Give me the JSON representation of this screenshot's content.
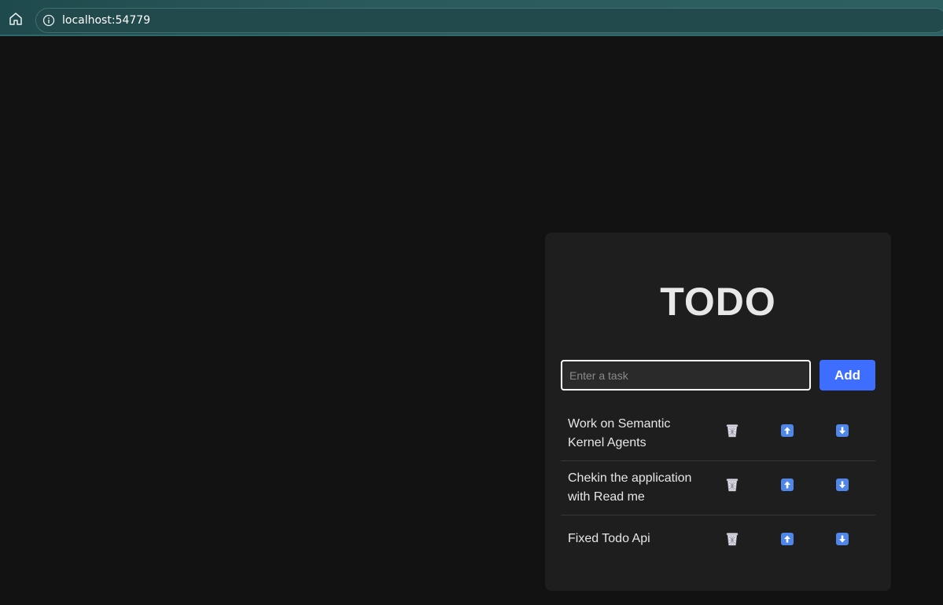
{
  "browser": {
    "url": "localhost:54779"
  },
  "app": {
    "title": "TODO",
    "input_placeholder": "Enter a task",
    "input_value": "",
    "add_label": "Add"
  },
  "tasks": [
    {
      "text": "Work on Semantic Kernel Agents"
    },
    {
      "text": "Chekin the application with Read me"
    },
    {
      "text": "Fixed Todo Api"
    }
  ],
  "icons": {
    "delete": "wastebasket-icon",
    "up": "arrow-up-icon",
    "down": "arrow-down-icon"
  },
  "colors": {
    "background": "#121212",
    "card": "#1e1e1e",
    "accent": "#3d6eff",
    "arrow_box": "#4f86e8"
  }
}
